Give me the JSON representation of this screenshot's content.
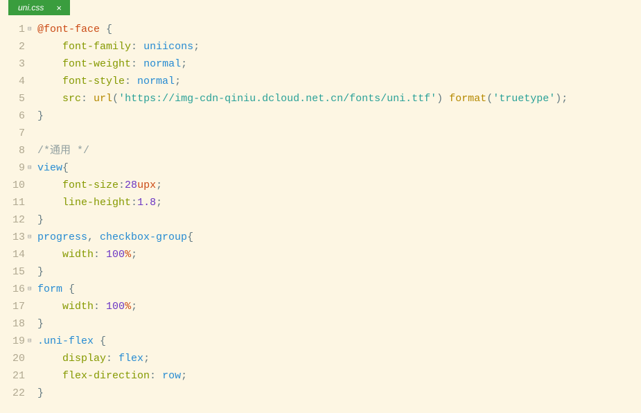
{
  "tab": {
    "filename": "uni.css",
    "close_glyph": "×"
  },
  "code": {
    "lines": [
      {
        "num": "1",
        "fold": "⊟",
        "tokens": [
          [
            "at-rule",
            "@font-face"
          ],
          [
            "punct",
            " "
          ],
          [
            "brace",
            "{"
          ]
        ]
      },
      {
        "num": "2",
        "fold": "",
        "indent": 1,
        "tokens": [
          [
            "",
            "    "
          ],
          [
            "property",
            "font-family"
          ],
          [
            "punct",
            ": "
          ],
          [
            "value",
            "uniicons"
          ],
          [
            "punct",
            ";"
          ]
        ]
      },
      {
        "num": "3",
        "fold": "",
        "indent": 1,
        "tokens": [
          [
            "",
            "    "
          ],
          [
            "property",
            "font-weight"
          ],
          [
            "punct",
            ": "
          ],
          [
            "value",
            "normal"
          ],
          [
            "punct",
            ";"
          ]
        ]
      },
      {
        "num": "4",
        "fold": "",
        "indent": 1,
        "tokens": [
          [
            "",
            "    "
          ],
          [
            "property",
            "font-style"
          ],
          [
            "punct",
            ": "
          ],
          [
            "value",
            "normal"
          ],
          [
            "punct",
            ";"
          ]
        ]
      },
      {
        "num": "5",
        "fold": "",
        "indent": 1,
        "tokens": [
          [
            "",
            "    "
          ],
          [
            "property",
            "src"
          ],
          [
            "punct",
            ": "
          ],
          [
            "func",
            "url"
          ],
          [
            "punct",
            "("
          ],
          [
            "string",
            "'https://img-cdn-qiniu.dcloud.net.cn/fonts/uni.ttf'"
          ],
          [
            "punct",
            ") "
          ],
          [
            "func",
            "format"
          ],
          [
            "punct",
            "("
          ],
          [
            "string",
            "'truetype'"
          ],
          [
            "punct",
            ");"
          ]
        ]
      },
      {
        "num": "6",
        "fold": "",
        "indent": 0,
        "tokens": [
          [
            "brace",
            "}"
          ]
        ]
      },
      {
        "num": "7",
        "fold": "",
        "tokens": []
      },
      {
        "num": "8",
        "fold": "",
        "tokens": [
          [
            "comment",
            "/*通用 */"
          ]
        ]
      },
      {
        "num": "9",
        "fold": "⊟",
        "tokens": [
          [
            "selector",
            "view"
          ],
          [
            "brace",
            "{"
          ]
        ]
      },
      {
        "num": "10",
        "fold": "",
        "indent": 1,
        "tokens": [
          [
            "",
            "    "
          ],
          [
            "property",
            "font-size"
          ],
          [
            "punct",
            ":"
          ],
          [
            "number",
            "28"
          ],
          [
            "unit",
            "upx"
          ],
          [
            "punct",
            ";"
          ]
        ]
      },
      {
        "num": "11",
        "fold": "",
        "indent": 1,
        "tokens": [
          [
            "",
            "    "
          ],
          [
            "property",
            "line-height"
          ],
          [
            "punct",
            ":"
          ],
          [
            "number",
            "1.8"
          ],
          [
            "punct",
            ";"
          ]
        ]
      },
      {
        "num": "12",
        "fold": "",
        "indent": 0,
        "tokens": [
          [
            "brace",
            "}"
          ]
        ]
      },
      {
        "num": "13",
        "fold": "⊟",
        "tokens": [
          [
            "selector",
            "progress"
          ],
          [
            "punct",
            ", "
          ],
          [
            "selector",
            "checkbox-group"
          ],
          [
            "brace",
            "{"
          ]
        ]
      },
      {
        "num": "14",
        "fold": "",
        "indent": 1,
        "tokens": [
          [
            "",
            "    "
          ],
          [
            "property",
            "width"
          ],
          [
            "punct",
            ": "
          ],
          [
            "number",
            "100"
          ],
          [
            "pct",
            "%"
          ],
          [
            "punct",
            ";"
          ]
        ]
      },
      {
        "num": "15",
        "fold": "",
        "indent": 0,
        "tokens": [
          [
            "brace",
            "}"
          ]
        ]
      },
      {
        "num": "16",
        "fold": "⊟",
        "tokens": [
          [
            "selector",
            "form"
          ],
          [
            "punct",
            " "
          ],
          [
            "brace",
            "{"
          ]
        ]
      },
      {
        "num": "17",
        "fold": "",
        "indent": 1,
        "tokens": [
          [
            "",
            "    "
          ],
          [
            "property",
            "width"
          ],
          [
            "punct",
            ": "
          ],
          [
            "number",
            "100"
          ],
          [
            "pct",
            "%"
          ],
          [
            "punct",
            ";"
          ]
        ]
      },
      {
        "num": "18",
        "fold": "",
        "indent": 0,
        "tokens": [
          [
            "brace",
            "}"
          ]
        ]
      },
      {
        "num": "19",
        "fold": "⊟",
        "tokens": [
          [
            "selector",
            ".uni-flex"
          ],
          [
            "punct",
            " "
          ],
          [
            "brace",
            "{"
          ]
        ]
      },
      {
        "num": "20",
        "fold": "",
        "indent": 1,
        "tokens": [
          [
            "",
            "    "
          ],
          [
            "property",
            "display"
          ],
          [
            "punct",
            ": "
          ],
          [
            "value",
            "flex"
          ],
          [
            "punct",
            ";"
          ]
        ]
      },
      {
        "num": "21",
        "fold": "",
        "indent": 1,
        "tokens": [
          [
            "",
            "    "
          ],
          [
            "property",
            "flex-direction"
          ],
          [
            "punct",
            ": "
          ],
          [
            "value",
            "row"
          ],
          [
            "punct",
            ";"
          ]
        ]
      },
      {
        "num": "22",
        "fold": "",
        "indent": 0,
        "tokens": [
          [
            "brace",
            "}"
          ]
        ]
      }
    ]
  }
}
